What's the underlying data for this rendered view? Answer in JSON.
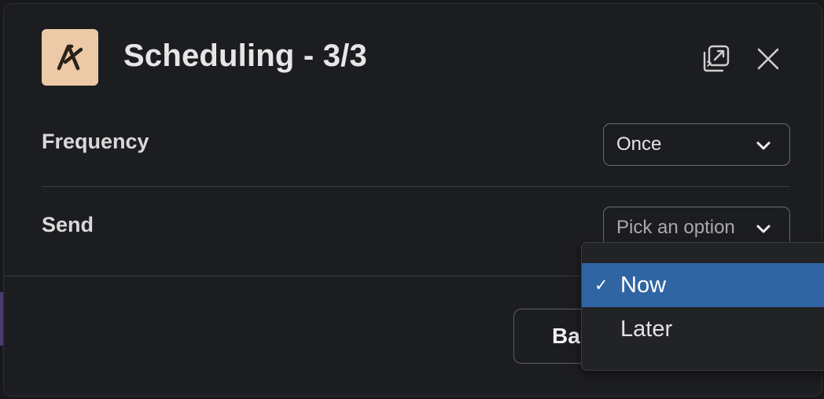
{
  "modal": {
    "title": "Scheduling - 3/3"
  },
  "fields": [
    {
      "label": "Frequency",
      "value": "Once"
    },
    {
      "label": "Send",
      "placeholder": "Pick an option"
    }
  ],
  "footer": {
    "back_label": "Back"
  },
  "dropdown": {
    "options": [
      {
        "label": "Now",
        "selected": true,
        "check": "✓"
      },
      {
        "label": "Later",
        "selected": false
      }
    ]
  },
  "colors": {
    "logo_bg": "#ecc9a7",
    "selected_option": "#2f65a3",
    "modal_bg": "#1c1d21"
  },
  "icons": {
    "app_logo": "app-logo-icon",
    "popout": "open-in-new-window-icon",
    "close": "close-icon",
    "chevron": "chevron-down-icon",
    "check": "check-icon"
  }
}
